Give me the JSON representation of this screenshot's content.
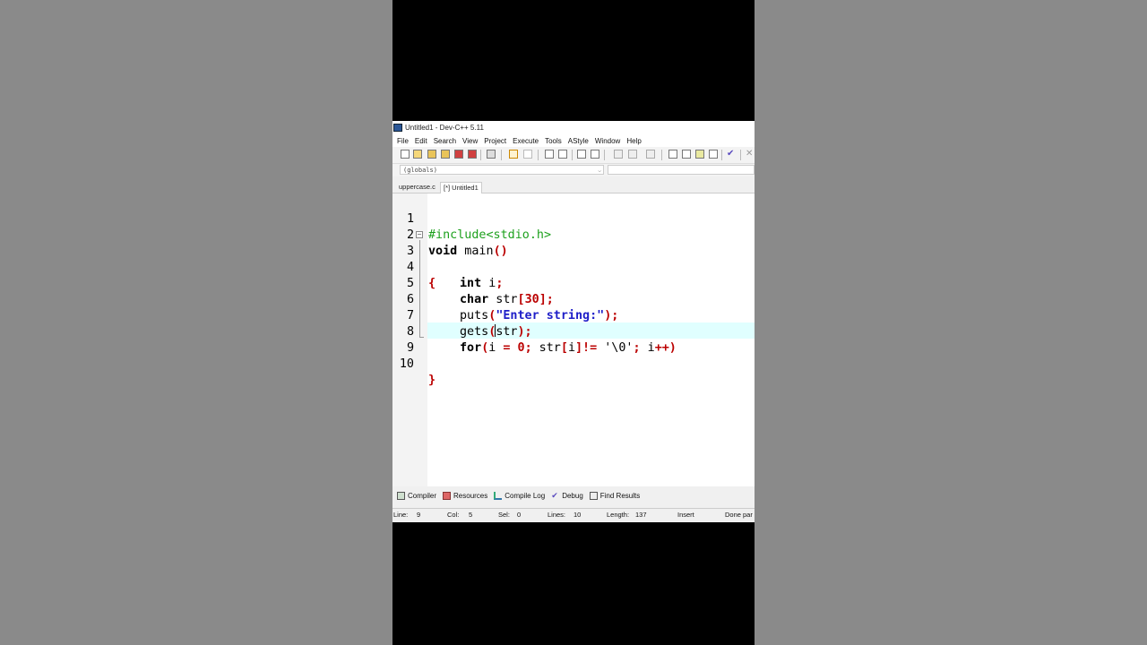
{
  "window": {
    "title": "Untitled1 - Dev-C++ 5.11"
  },
  "menu": [
    "File",
    "Edit",
    "Search",
    "View",
    "Project",
    "Execute",
    "Tools",
    "AStyle",
    "Window",
    "Help"
  ],
  "combo": {
    "value": "(globals)"
  },
  "tabs": [
    {
      "label": "uppercase.c"
    },
    {
      "label": "[*] Untitled1"
    }
  ],
  "editor": {
    "line_numbers": [
      "1",
      "2",
      "3",
      "4",
      "5",
      "6",
      "7",
      "8",
      "9",
      "10"
    ],
    "lines": {
      "l1_pp": "#include<stdio.h>",
      "l2_kw": "void",
      "l2_rest": " main",
      "l2_sym": "()",
      "l3_sym": "{",
      "l4_kw": "int",
      "l4_rest": " i",
      "l4_sym": ";",
      "l5_kw": "char",
      "l5_rest": " str",
      "l5_sym1": "[",
      "l5_num": "30",
      "l5_sym2": "];",
      "l6_rest": "puts",
      "l6_sym1": "(",
      "l6_str": "\"Enter string:\"",
      "l6_sym2": ");",
      "l7_rest": "gets",
      "l7_sym1": "(",
      "l7_mid": "str",
      "l7_sym2": ");",
      "l8_kw": "for",
      "l8_sym1": "(",
      "l8_a": "i ",
      "l8_eq": "=",
      "l8_sp": " ",
      "l8_num": "0",
      "l8_semi": ";",
      "l8_b": " str",
      "l8_br1": "[",
      "l8_i": "i",
      "l8_br2": "]!=",
      "l8_sp2": " ",
      "l8_chr": "'\\0'",
      "l8_semi2": ";",
      "l8_c": " i",
      "l8_end": "++)",
      "l10_sym": "}"
    }
  },
  "bottom_tabs": [
    {
      "label": "Compiler",
      "icon": "compiler-icon"
    },
    {
      "label": "Resources",
      "icon": "resources-icon"
    },
    {
      "label": "Compile Log",
      "icon": "compile-log-icon"
    },
    {
      "label": "Debug",
      "icon": "debug-icon"
    },
    {
      "label": "Find Results",
      "icon": "find-results-icon"
    }
  ],
  "status": {
    "line_label": "Line:",
    "line_value": "9",
    "col_label": "Col:",
    "col_value": "5",
    "sel_label": "Sel:",
    "sel_value": "0",
    "lines_label": "Lines:",
    "lines_value": "10",
    "length_label": "Length:",
    "length_value": "137",
    "mode": "Insert",
    "message": "Done par"
  }
}
